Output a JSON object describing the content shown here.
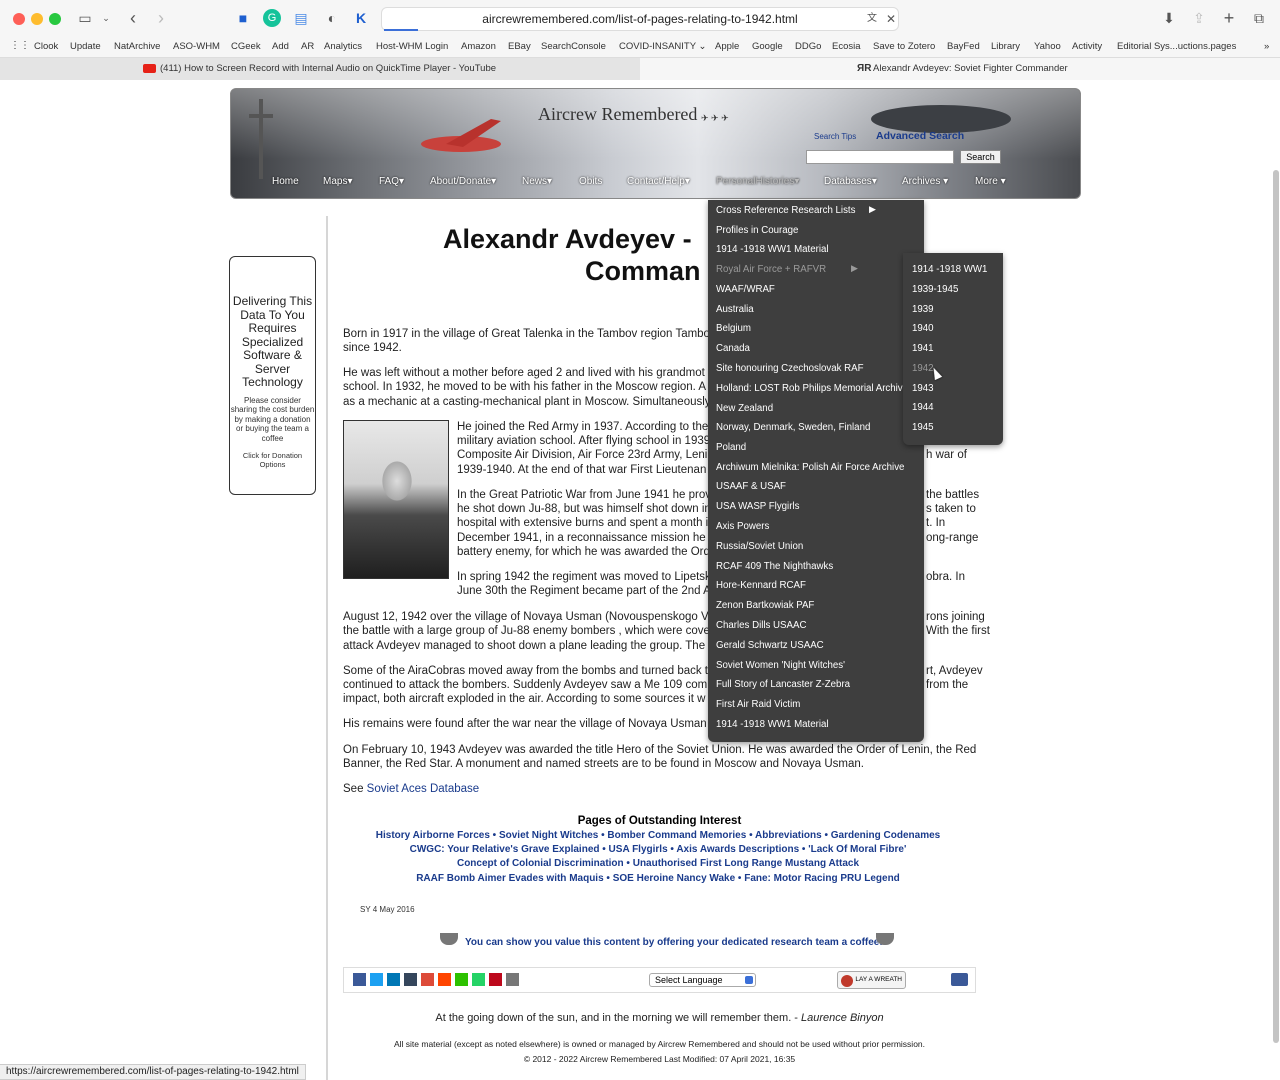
{
  "browser": {
    "url": "aircrewremembered.com/list-of-pages-relating-to-1942.html",
    "bookmarks": [
      "Clook",
      "Update",
      "NatArchive",
      "ASO-WHM",
      "CGeek",
      "Add",
      "AR",
      "Analytics",
      "Host-WHM Login",
      "Amazon",
      "EBay",
      "SearchConsole",
      "COVID-INSANITY",
      "Apple",
      "Google",
      "DDGo",
      "Ecosia",
      "Save to Zotero",
      "BayFed",
      "Library",
      "Yahoo",
      "Activity",
      "Editorial Sys...uctions.pages"
    ],
    "tabs": [
      {
        "label": "(411) How to Screen Record with Internal Audio on QuickTime Player - YouTube"
      },
      {
        "label": "Alexandr Avdeyev: Soviet Fighter Commander"
      }
    ],
    "status_url": "https://aircrewremembered.com/list-of-pages-relating-to-1942.html"
  },
  "banner": {
    "site_title": "Aircrew Remembered",
    "search_tips": "Search Tips",
    "advanced_search": "Advanced Search",
    "search_button": "Search",
    "nav": [
      "Home",
      "Maps",
      "FAQ",
      "About/Donate",
      "News",
      "Obits",
      "Contact/Help",
      "PersonalHistories",
      "Databases",
      "Archives",
      "More"
    ]
  },
  "donate": {
    "headline": "Delivering This Data To You Requires Specialized Software & Server Technology",
    "body": "Please consider sharing the cost burden by making a donation or buying the team a coffee",
    "click": "Click for Donation Options"
  },
  "article": {
    "title_line1": "Alexandr Avdeyev -",
    "title_line2": "Comman",
    "p1a": "Born in 1917 in the village of Great Talenka in the Tambov region Tambo",
    "p1b": "since 1942.",
    "p2a": "He was left without a mother before aged 2 and lived with his grandmot",
    "p2b": "school. In 1932, he moved to be with his father in the Moscow region. A",
    "p2c": "as a mechanic at a casting-mechanical plant in Moscow. Simultaneously,",
    "p3a": "He joined the Red Army in 1937. According to the",
    "p3b": "military aviation school. After flying school in 1939",
    "p3c": "Composite Air Division, Air Force 23rd Army, Leni",
    "p3c_right": "h war of",
    "p3d": "1939-1940. At the end of that war First Lieutenan",
    "p4a": "In the Great Patriotic War from June 1941 he prov",
    "p4a_right": "the battles",
    "p4b": "he shot down Ju-88, but was himself shot down in",
    "p4b_right": "s taken to",
    "p4c": "hospital with extensive burns and spent a month i",
    "p4c_right": "t. In",
    "p4d": "December 1941, in a reconnaissance mission he c",
    "p4d_right": "ong-range",
    "p4e": "battery enemy, for which he was awarded the Ord",
    "p5a": "In spring 1942 the regiment was moved to Lipetsk",
    "p5a_right": "obra. In",
    "p5b": "June 30th the Regiment became part of the 2nd A",
    "p6a": "August 12, 1942 over the village of Novaya Usman (Novouspenskogo Vo",
    "p6a_right": "rons joining",
    "p6b": "the battle with a large group of Ju-88 enemy bombers , which were cove",
    "p6b_right": "With the first",
    "p6c": "attack Avdeyev managed to shoot down a plane leading the group. The",
    "p7a": "Some of the AiraCobras moved away from the bombs and turned back t",
    "p7a_right": "rt, Avdeyev",
    "p7b": "continued to attack the bombers. Suddenly Avdeyev saw a Me 109 com",
    "p7b_right": "from the",
    "p7c": "impact, both aircraft exploded in the air. According to some sources it w",
    "p8": "His remains were found after the war near the village of Novaya Usman b",
    "p9a": "On February 10, 1943 Avdeyev was awarded the title Hero of the Soviet Union. He was awarded the Order of Lenin, the Red",
    "p9b": "Banner, the Red Star. A monument and named streets are to be found in Moscow and Novaya Usman.",
    "see_prefix": "See",
    "see_link": "Soviet Aces Database"
  },
  "outstanding": {
    "title": "Pages of Outstanding Interest",
    "line1": [
      "History Airborne Forces",
      "Soviet Night Witches",
      "Bomber Command Memories",
      "Abbreviations",
      "Gardening Codenames"
    ],
    "line2": [
      "CWGC: Your Relative's Grave Explained",
      "USA Flygirls",
      "Axis Awards Descriptions",
      "'Lack Of Moral Fibre'"
    ],
    "line3": [
      "Concept of Colonial Discrimination",
      "Unauthorised First Long Range Mustang Attack"
    ],
    "line4": [
      "RAAF Bomb Aimer Evades with Maquis",
      "SOE Heroine Nancy Wake",
      "Fane: Motor Racing PRU Legend"
    ]
  },
  "footer": {
    "sy": "SY 4 May 2016",
    "coffee": "You can show you value this content by offering your dedicated research team a coffee!",
    "select_language": "Select Language",
    "wreath": "LAY A WREATH",
    "quote": "At the going down of the sun, and in the morning we will remember them. -",
    "quote_author": "Laurence Binyon",
    "fine1": "All site material (except as noted elsewhere) is owned or managed by Aircrew Remembered and should not be used without prior permission.",
    "fine2": "© 2012 - 2022 Aircrew Remembered Last Modified: 07 April 2021, 16:35"
  },
  "menu": {
    "items": [
      {
        "label": "Cross Reference Research Lists",
        "arrow": "▶"
      },
      {
        "label": "Profiles in Courage"
      },
      {
        "label": "1914 -1918 WW1 Material"
      },
      {
        "label": "Royal Air Force + RAFVR",
        "arrow": "▶"
      },
      {
        "label": "WAAF/WRAF"
      },
      {
        "label": "Australia"
      },
      {
        "label": "Belgium"
      },
      {
        "label": "Canada"
      },
      {
        "label": "Site honouring Czechoslovak RAF"
      },
      {
        "label": "Holland: LOST Rob Philips Memorial Archiv"
      },
      {
        "label": "New Zealand"
      },
      {
        "label": "Norway, Denmark, Sweden, Finland"
      },
      {
        "label": "Poland"
      },
      {
        "label": "Archiwum Mielnika: Polish Air Force Archive"
      },
      {
        "label": "USAAF & USAF"
      },
      {
        "label": "USA WASP Flygirls"
      },
      {
        "label": "Axis Powers"
      },
      {
        "label": "Russia/Soviet Union"
      },
      {
        "label": "RCAF 409 The Nighthawks"
      },
      {
        "label": "Hore-Kennard RCAF"
      },
      {
        "label": "Zenon Bartkowiak PAF"
      },
      {
        "label": "Charles Dills USAAC"
      },
      {
        "label": "Gerald Schwartz USAAC"
      },
      {
        "label": "Soviet Women 'Night Witches'"
      },
      {
        "label": "Full Story of Lancaster Z-Zebra"
      },
      {
        "label": "First Air Raid Victim"
      },
      {
        "label": "1914 -1918 WW1 Material"
      }
    ],
    "submenu": [
      "1914 -1918 WW1",
      "1939-1945",
      "1939",
      "1940",
      "1941",
      "1942",
      "1943",
      "1944",
      "1945"
    ]
  }
}
